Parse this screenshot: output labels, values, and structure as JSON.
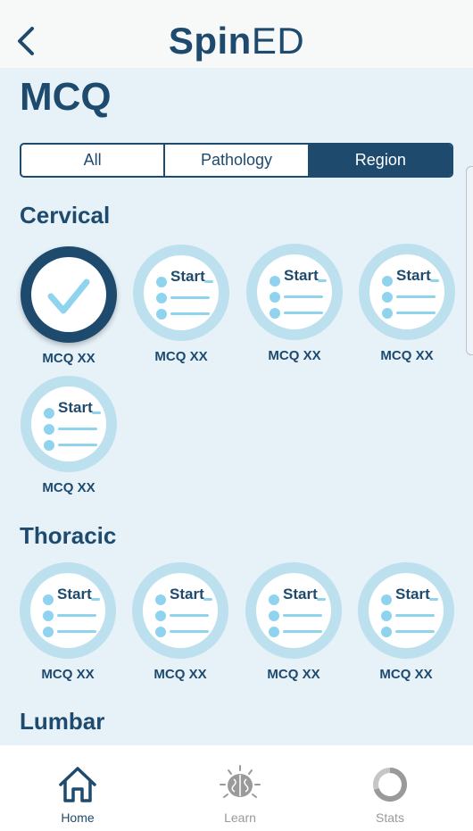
{
  "header": {
    "logo_bold": "Spin",
    "logo_light": "ED"
  },
  "page": {
    "title": "MCQ"
  },
  "filter": {
    "options": [
      "All",
      "Pathology",
      "Region"
    ],
    "selected": "Region"
  },
  "sections": [
    {
      "title": "Cervical",
      "items": [
        {
          "label": "MCQ XX",
          "status": "completed",
          "start_text": ""
        },
        {
          "label": "MCQ XX",
          "status": "not-started",
          "start_text": "Start"
        },
        {
          "label": "MCQ XX",
          "status": "not-started",
          "start_text": "Start"
        },
        {
          "label": "MCQ XX",
          "status": "not-started",
          "start_text": "Start"
        },
        {
          "label": "MCQ XX",
          "status": "not-started",
          "start_text": "Start"
        }
      ]
    },
    {
      "title": "Thoracic",
      "items": [
        {
          "label": "MCQ XX",
          "status": "not-started",
          "start_text": "Start"
        },
        {
          "label": "MCQ XX",
          "status": "not-started",
          "start_text": "Start"
        },
        {
          "label": "MCQ XX",
          "status": "not-started",
          "start_text": "Start"
        },
        {
          "label": "MCQ XX",
          "status": "not-started",
          "start_text": "Start"
        }
      ]
    },
    {
      "title": "Lumbar",
      "items": []
    }
  ],
  "tabbar": {
    "items": [
      {
        "label": "Home",
        "icon": "home-icon",
        "active": true
      },
      {
        "label": "Learn",
        "icon": "brain-icon",
        "active": false
      },
      {
        "label": "Stats",
        "icon": "donut-chart-icon",
        "active": false
      }
    ]
  },
  "colors": {
    "primary": "#1e4a6e",
    "background": "#e6f1f8",
    "ring": "#bde0ee",
    "accent": "#8fd3ef",
    "inactive": "#9a9a9a"
  }
}
